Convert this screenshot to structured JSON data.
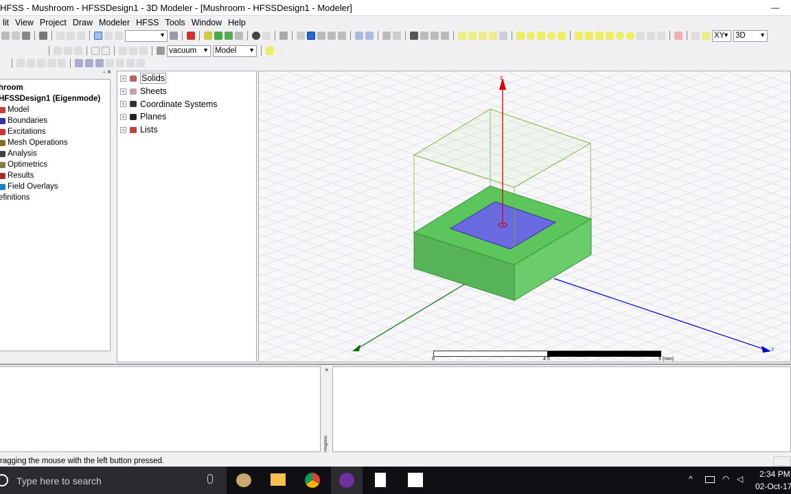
{
  "window": {
    "title": "HFSS  - Mushroom - HFSSDesign1 - 3D Modeler - [Mushroom - HFSSDesign1 - Modeler]",
    "minimize": "—"
  },
  "menu": [
    "lit",
    "View",
    "Project",
    "Draw",
    "Modeler",
    "HFSS",
    "Tools",
    "Window",
    "Help"
  ],
  "toolbar": {
    "material": "vacuum",
    "mode": "Model",
    "plane": "XY",
    "view": "3D",
    "active_tool": "rotate-icon"
  },
  "project_tree": {
    "close": "- ×",
    "items": [
      {
        "label": "hroom",
        "bold": true,
        "icon": "project-icon",
        "color": ""
      },
      {
        "label": "HFSSDesign1 (Eigenmode)",
        "bold": true,
        "icon": "design-icon",
        "color": ""
      },
      {
        "label": "Model",
        "icon": "model-icon",
        "color": "#c04040"
      },
      {
        "label": "Boundaries",
        "icon": "boundaries-icon",
        "color": "#3030a0"
      },
      {
        "label": "Excitations",
        "icon": "excitations-icon",
        "color": "#d03030"
      },
      {
        "label": "Mesh Operations",
        "icon": "mesh-icon",
        "color": "#807020"
      },
      {
        "label": "Analysis",
        "icon": "analysis-icon",
        "color": "#404040"
      },
      {
        "label": "Optimetrics",
        "icon": "optimetrics-icon",
        "color": "#808040"
      },
      {
        "label": "Results",
        "icon": "results-icon",
        "color": "#a03030"
      },
      {
        "label": "Field Overlays",
        "icon": "field-overlays-icon",
        "color": "#2080c0"
      },
      {
        "label": "efinitions",
        "icon": "",
        "color": ""
      }
    ]
  },
  "model_tree": {
    "items": [
      {
        "label": "Solids",
        "icon": "solids-icon",
        "selected": true
      },
      {
        "label": "Sheets",
        "icon": "sheets-icon"
      },
      {
        "label": "Coordinate Systems",
        "icon": "coordinate-systems-icon"
      },
      {
        "label": "Planes",
        "icon": "planes-icon"
      },
      {
        "label": "Lists",
        "icon": "lists-icon"
      }
    ]
  },
  "viewport": {
    "axes": {
      "z": "Z",
      "y": "Y"
    },
    "scale": {
      "ticks": [
        "0",
        "4.5",
        "9"
      ],
      "unit": "(mm)"
    },
    "colors": {
      "substrate": "#5cc55c",
      "patch": "#6a6ae0",
      "airbox": "#7ab040",
      "z_axis": "#e00000",
      "x_axis": "#007000",
      "y_axis": "#0000c0",
      "background": "#f8f8fa"
    }
  },
  "progress_label": "Progress",
  "status": "ragging the mouse with the left button pressed.",
  "taskbar": {
    "search_placeholder": "Type here to search",
    "time": "2:34 PM",
    "date": "02-Oct-17"
  }
}
